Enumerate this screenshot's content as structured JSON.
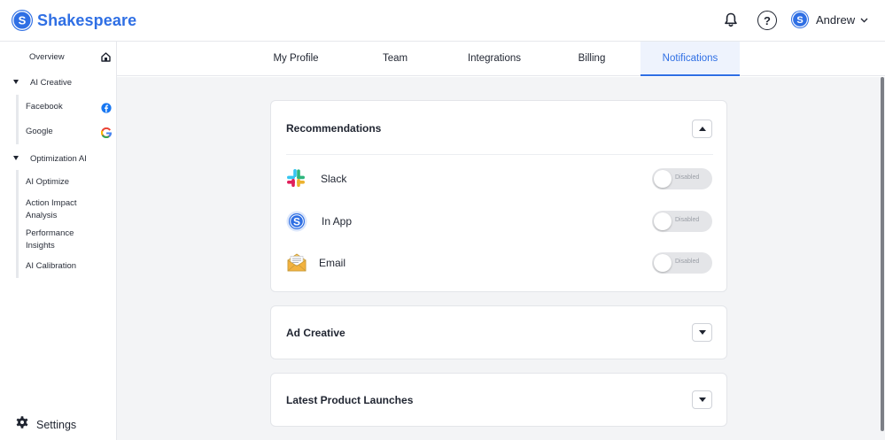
{
  "brand": {
    "name": "Shakespeare",
    "logo_letter": "S",
    "color": "#2f6fe4"
  },
  "header": {
    "bell_icon": "bell-icon",
    "help_glyph": "?",
    "user": {
      "avatar_letter": "S",
      "name": "Andrew"
    }
  },
  "sidebar": {
    "overview": "Overview",
    "ai_creative": {
      "label": "AI Creative",
      "items": [
        {
          "label": "Facebook",
          "icon": "facebook-icon"
        },
        {
          "label": "Google",
          "icon": "google-icon"
        }
      ]
    },
    "optimization": {
      "label": "Optimization AI",
      "items": [
        {
          "label": "AI Optimize"
        },
        {
          "label": "Action Impact Analysis"
        },
        {
          "label": "Performance Insights"
        },
        {
          "label": "AI Calibration"
        }
      ]
    },
    "settings": "Settings"
  },
  "tabs": [
    {
      "label": "My Profile",
      "active": false
    },
    {
      "label": "Team",
      "active": false
    },
    {
      "label": "Integrations",
      "active": false
    },
    {
      "label": "Billing",
      "active": false
    },
    {
      "label": "Notifications",
      "active": true
    }
  ],
  "cards": {
    "recommendations": {
      "title": "Recommendations",
      "expanded": true,
      "channels": [
        {
          "label": "Slack",
          "icon": "slack-icon",
          "status": "Disabled"
        },
        {
          "label": "In App",
          "icon": "shakespeare-app-icon",
          "status": "Disabled"
        },
        {
          "label": "Email",
          "icon": "envelope-icon",
          "status": "Disabled"
        }
      ]
    },
    "ad_creative": {
      "title": "Ad Creative",
      "expanded": false
    },
    "latest_launches": {
      "title": "Latest Product Launches",
      "expanded": false
    }
  }
}
